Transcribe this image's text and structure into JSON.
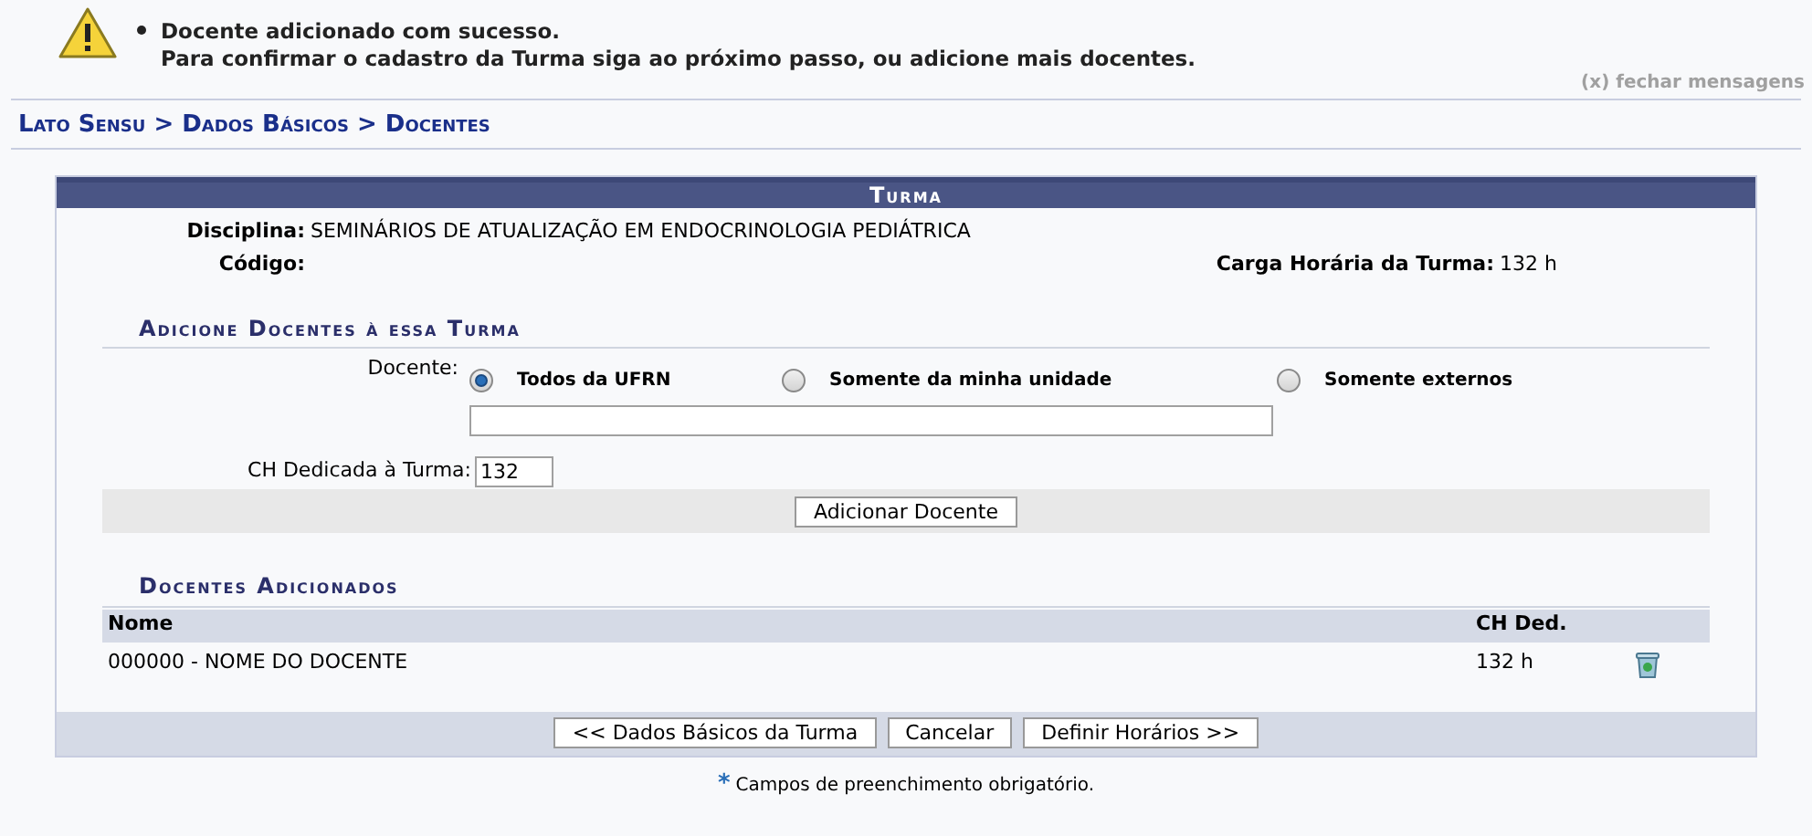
{
  "messages": {
    "items": [
      "Docente adicionado com sucesso.",
      "Para confirmar o cadastro da Turma siga ao próximo passo, ou adicione mais docentes."
    ],
    "close": "(x) fechar mensagens"
  },
  "breadcrumb": "Lato Sensu > Dados Básicos > Docentes",
  "form": {
    "title": "Turma",
    "disciplina": {
      "label": "Disciplina:",
      "value": "SEMINÁRIOS DE ATUALIZAÇÃO EM ENDOCRINOLOGIA PEDIÁTRICA"
    },
    "codigo": {
      "label": "Código:"
    },
    "carga": {
      "label": "Carga Horária da Turma:",
      "value": "132 h"
    },
    "add_section": {
      "title": "Adicione Docentes à essa Turma",
      "docente_label": "Docente:",
      "options": [
        {
          "label": "Todos da UFRN",
          "selected": true
        },
        {
          "label": "Somente da minha unidade",
          "selected": false
        },
        {
          "label": "Somente externos",
          "selected": false
        }
      ],
      "ch_label": "CH Dedicada à Turma:",
      "ch_value": "132",
      "add_button": "Adicionar Docente"
    },
    "added_section": {
      "title": "Docentes Adicionados",
      "columns": [
        "Nome",
        "CH Ded."
      ],
      "rows": [
        {
          "name": "000000 - NOME DO DOCENTE",
          "ch": "132 h"
        }
      ]
    },
    "buttons": [
      "<< Dados Básicos da Turma",
      "Cancelar",
      "Definir Horários >>"
    ]
  },
  "footnote": {
    "star": "*",
    "text": "Campos de preenchimento obrigatório."
  }
}
